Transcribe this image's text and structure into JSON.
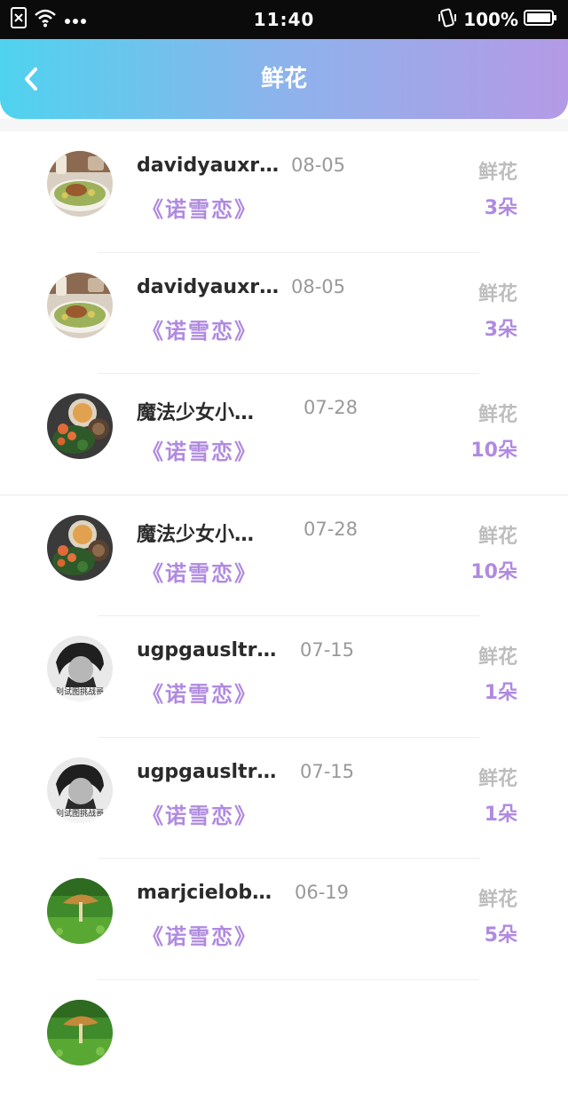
{
  "status_bar": {
    "time": "11:40",
    "battery": "100%",
    "icons": [
      "sim-off-icon",
      "wifi-icon",
      "more-dots-icon",
      "vibrate-icon",
      "battery-icon"
    ]
  },
  "header": {
    "title": "鲜花",
    "back_icon": "chevron-left-icon"
  },
  "colors": {
    "header_gradient_start": "#4fd3ee",
    "header_gradient_end": "#b49ae6",
    "accent_purple": "#b08ae0",
    "muted_gray": "#999999"
  },
  "items": [
    {
      "username": "davidyauxrman",
      "date": "08-05",
      "work": "《诺雪恋》",
      "gift": "鲜花",
      "count": "3朵",
      "avatar": "food-salad"
    },
    {
      "username": "davidyauxrman",
      "date": "08-05",
      "work": "《诺雪恋》",
      "gift": "鲜花",
      "count": "3朵",
      "avatar": "food-salad"
    },
    {
      "username": "魔法少女小…",
      "date": "07-28",
      "work": "《诺雪恋》",
      "gift": "鲜花",
      "count": "10朵",
      "avatar": "food-bowl"
    },
    {
      "username": "魔法少女小…",
      "date": "07-28",
      "work": "《诺雪恋》",
      "gift": "鲜花",
      "count": "10朵",
      "avatar": "food-bowl"
    },
    {
      "username": "ugpgausltralipa",
      "date": "07-15",
      "work": "《诺雪恋》",
      "gift": "鲜花",
      "count": "1朵",
      "avatar": "person-bw",
      "avatar_caption": "别试图挑战哥"
    },
    {
      "username": "ugpgausltralipa",
      "date": "07-15",
      "work": "《诺雪恋》",
      "gift": "鲜花",
      "count": "1朵",
      "avatar": "person-bw",
      "avatar_caption": "别试图挑战哥"
    },
    {
      "username": "marjcieloburlon",
      "date": "06-19",
      "work": "《诺雪恋》",
      "gift": "鲜花",
      "count": "5朵",
      "avatar": "mushroom-green"
    }
  ]
}
